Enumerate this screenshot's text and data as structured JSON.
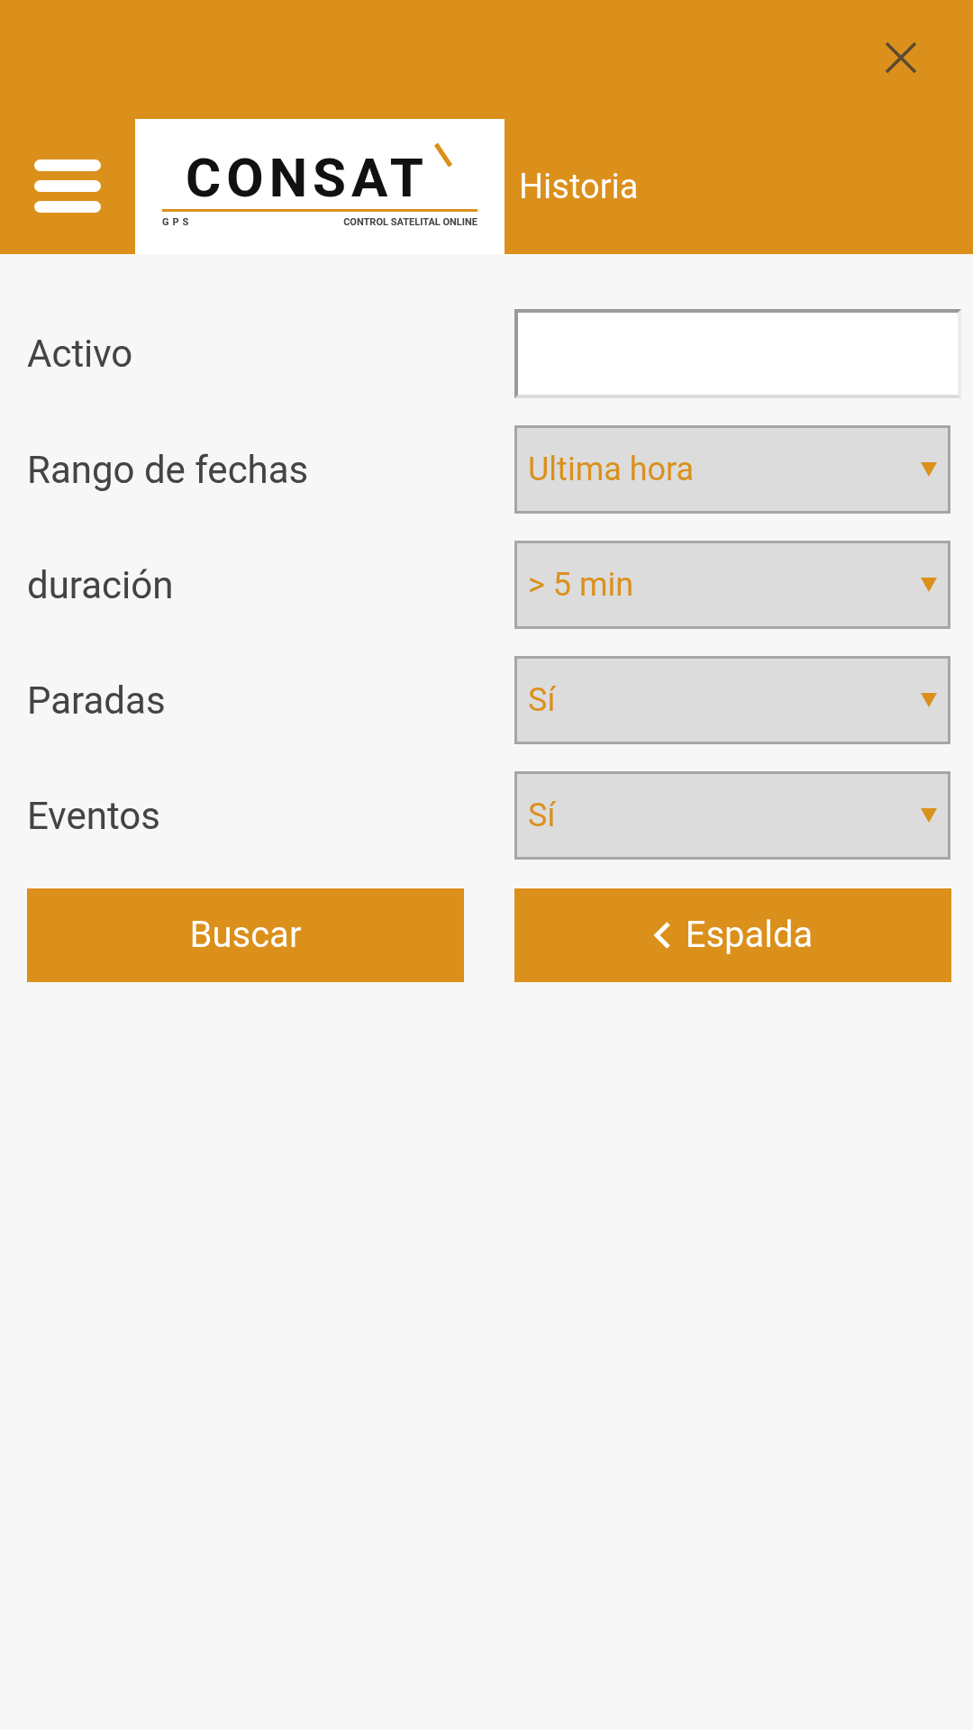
{
  "header": {
    "title": "Historia",
    "logo": {
      "wordmark": "CONSAT",
      "left_tag": "GPS",
      "tagline": "CONTROL SATELITAL ONLINE"
    }
  },
  "form": {
    "fields": [
      {
        "kind": "text",
        "label": "Activo"
      },
      {
        "kind": "select",
        "label": "Rango de fechas",
        "value": "Ultima hora"
      },
      {
        "kind": "select",
        "label": "duración",
        "value": "> 5 min"
      },
      {
        "kind": "select",
        "label": "Paradas",
        "value": "Sí"
      },
      {
        "kind": "select",
        "label": "Eventos",
        "value": "Sí"
      }
    ]
  },
  "buttons": [
    {
      "kind": "primary",
      "label": "Buscar"
    },
    {
      "kind": "back",
      "label": "Espalda"
    }
  ]
}
